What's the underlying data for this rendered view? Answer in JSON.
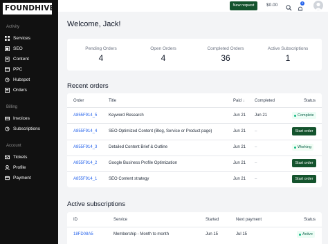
{
  "brand": {
    "logo": "FOUNDHIVE."
  },
  "sidebar": {
    "sections": [
      {
        "title": "Activity",
        "items": [
          {
            "label": "Services",
            "icon": "grid-icon"
          },
          {
            "label": "SEO",
            "icon": "seo-icon"
          },
          {
            "label": "Content",
            "icon": "content-icon"
          },
          {
            "label": "PPC",
            "icon": "ppc-icon"
          },
          {
            "label": "Hubspot",
            "icon": "hubspot-icon"
          },
          {
            "label": "Orders",
            "icon": "orders-icon"
          }
        ]
      },
      {
        "title": "Billing",
        "items": [
          {
            "label": "Invoices",
            "icon": "invoice-icon"
          },
          {
            "label": "Subscriptions",
            "icon": "subscriptions-icon"
          }
        ]
      },
      {
        "title": "Account",
        "items": [
          {
            "label": "Tickets",
            "icon": "ticket-icon"
          },
          {
            "label": "Profile",
            "icon": "profile-icon"
          },
          {
            "label": "Payment",
            "icon": "payment-icon"
          }
        ]
      }
    ]
  },
  "topbar": {
    "new_request": "New request",
    "balance": "$0.00",
    "notification_count": "2"
  },
  "main": {
    "title": "Welcome, Jack!",
    "stats": [
      {
        "label": "Pending Orders",
        "value": "4"
      },
      {
        "label": "Open Orders",
        "value": "4"
      },
      {
        "label": "Completed Orders",
        "value": "36"
      },
      {
        "label": "Active Subscriptions",
        "value": "1"
      }
    ],
    "recent_orders": {
      "heading": "Recent orders",
      "columns": {
        "order": "Order",
        "title": "Title",
        "paid": "Paid",
        "completed": "Completed",
        "status": "Status"
      },
      "rows": [
        {
          "order": "A855F914_5",
          "title": "Keyword Research",
          "paid": "Jun 21",
          "completed": "Jun 21",
          "status": "Complete",
          "status_type": "chip-complete"
        },
        {
          "order": "A855F914_4",
          "title": "SEO Optimized Content (Blog, Service or Product page)",
          "paid": "Jun 21",
          "completed": "–",
          "status": "Start order",
          "status_type": "button"
        },
        {
          "order": "A855F914_3",
          "title": "Detailed Content Brief & Outline",
          "paid": "Jun 21",
          "completed": "–",
          "status": "Working",
          "status_type": "chip-working"
        },
        {
          "order": "A855F914_2",
          "title": "Google Business Profile Optimization",
          "paid": "Jun 21",
          "completed": "–",
          "status": "Start order",
          "status_type": "button"
        },
        {
          "order": "A855F914_1",
          "title": "SEO Content strategy",
          "paid": "Jun 21",
          "completed": "–",
          "status": "Start order",
          "status_type": "button"
        }
      ]
    },
    "active_subscriptions": {
      "heading": "Active subscriptions",
      "columns": {
        "id": "ID",
        "service": "Service",
        "started": "Started",
        "next_payment": "Next payment",
        "status": "Status"
      },
      "rows": [
        {
          "id": "18FD08A5",
          "service": "Membership - Month to month",
          "started": "Jun 15",
          "next_payment": "Jul 15",
          "status": "Active"
        }
      ]
    }
  }
}
